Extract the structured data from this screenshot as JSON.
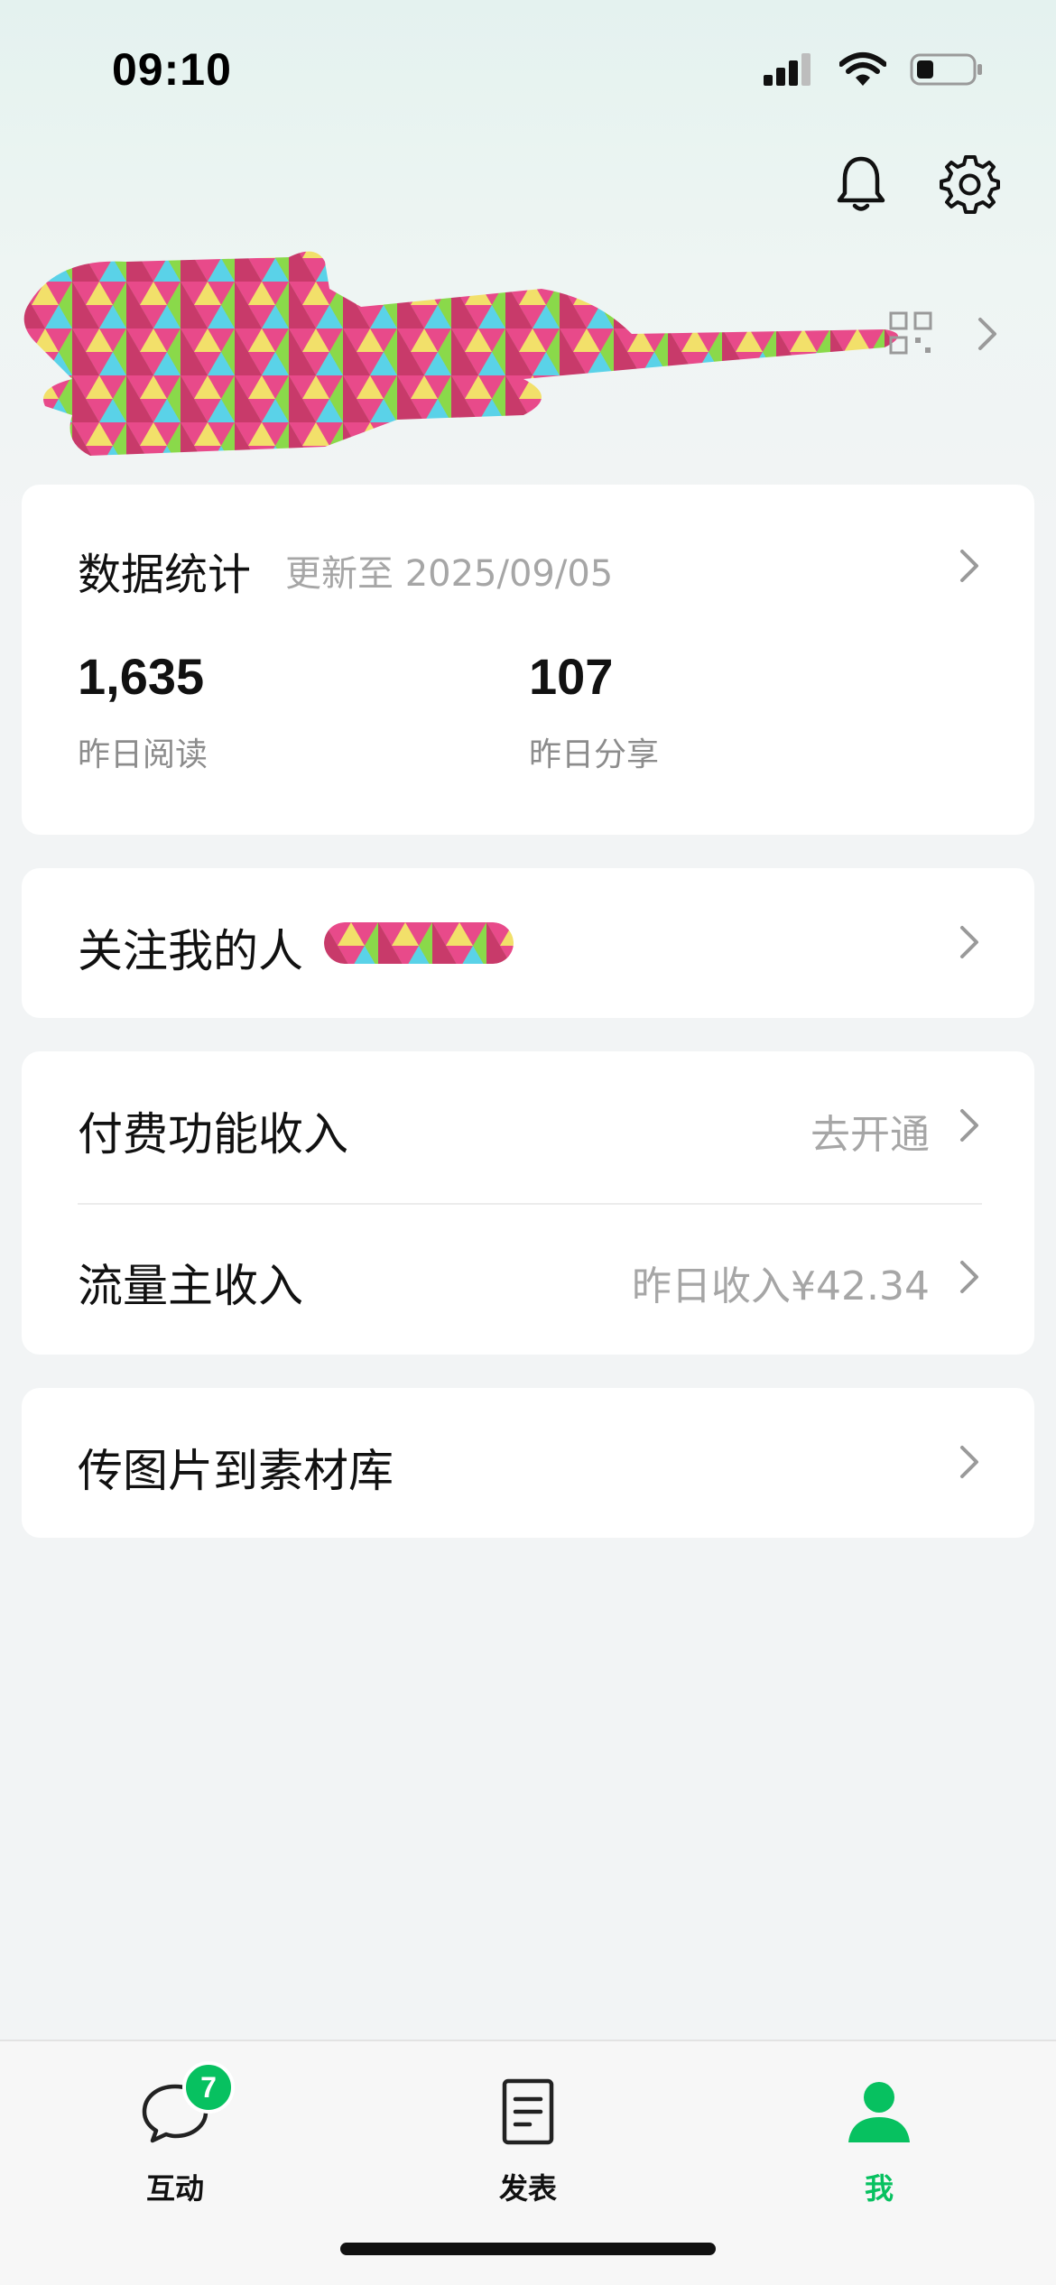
{
  "status_bar": {
    "time": "09:10"
  },
  "stats_card": {
    "title": "数据统计",
    "updated": "更新至 2025/09/05",
    "stats": [
      {
        "value": "1,635",
        "label": "昨日阅读"
      },
      {
        "value": "107",
        "label": "昨日分享"
      }
    ]
  },
  "followers": {
    "label": "关注我的人"
  },
  "income": {
    "paid_label": "付费功能收入",
    "paid_action": "去开通",
    "traffic_label": "流量主收入",
    "traffic_value": "昨日收入¥42.34"
  },
  "upload": {
    "label": "传图片到素材库"
  },
  "tabbar": {
    "tabs": [
      {
        "label": "互动",
        "icon": "chat-bubble-icon",
        "badge": "7"
      },
      {
        "label": "发表",
        "icon": "document-icon"
      },
      {
        "label": "我",
        "icon": "person-icon",
        "active": true
      }
    ]
  },
  "colors": {
    "accent": "#07c160",
    "muted_text": "#a6a6a6"
  }
}
